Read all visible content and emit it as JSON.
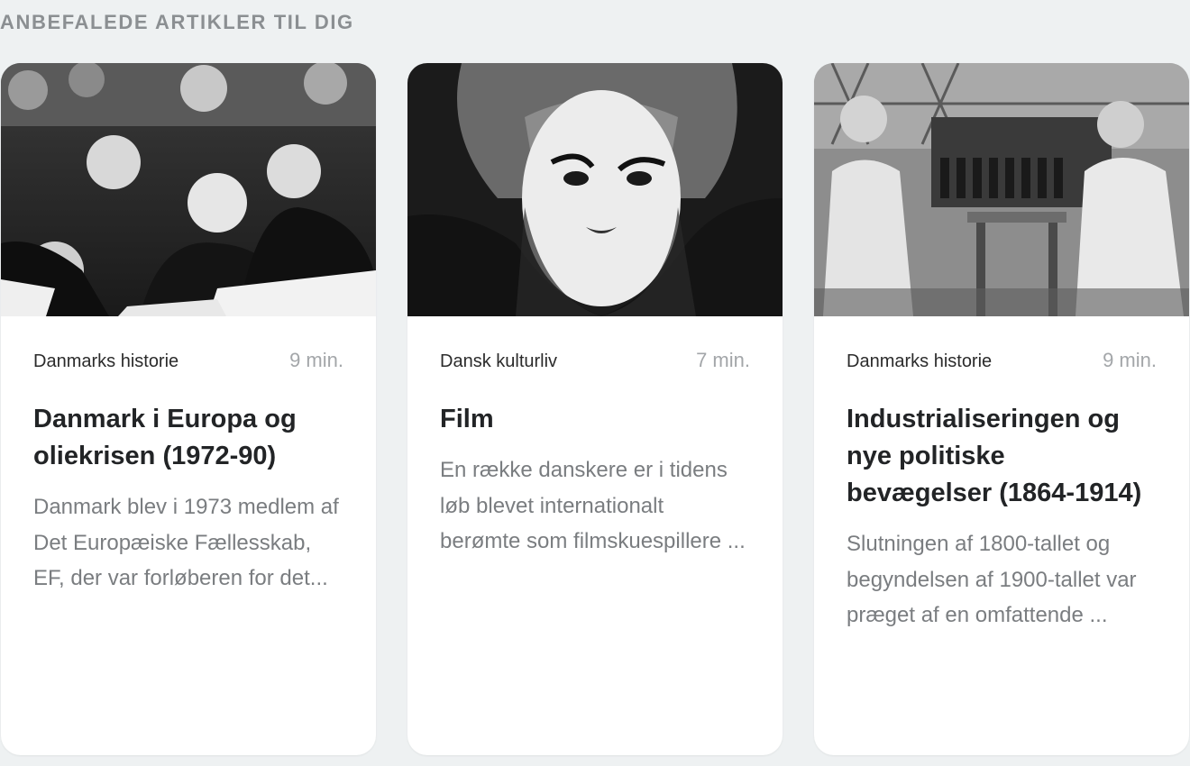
{
  "section": {
    "title": "ANBEFALEDE ARTIKLER TIL DIG"
  },
  "cards": [
    {
      "image_icon": "photo-politicians-at-table",
      "category": "Danmarks historie",
      "read_time": "9 min.",
      "title": "Danmark i Europa og oliekrisen (1972-90)",
      "excerpt": "Danmark blev i 1973 medlem af Det Europæiske Fællesskab, EF, der var forløberen for det..."
    },
    {
      "image_icon": "photo-film-actress-portrait",
      "category": "Dansk kulturliv",
      "read_time": "7 min.",
      "title": "Film",
      "excerpt": "En række danskere er i tidens løb blevet internationalt berømte som filmskuespillere ..."
    },
    {
      "image_icon": "photo-women-factory-workers",
      "category": "Danmarks historie",
      "read_time": "9 min.",
      "title": "Industrialiseringen og nye politiske bevægelser (1864-1914)",
      "excerpt": "Slutningen af 1800-tallet og begyndelsen af 1900-tallet var præget af en omfattende ..."
    }
  ],
  "colors": {
    "background": "#eef1f2",
    "card": "#ffffff",
    "title_text": "#222426",
    "muted_text": "#7a7d80",
    "section_title": "#8b8f92"
  }
}
